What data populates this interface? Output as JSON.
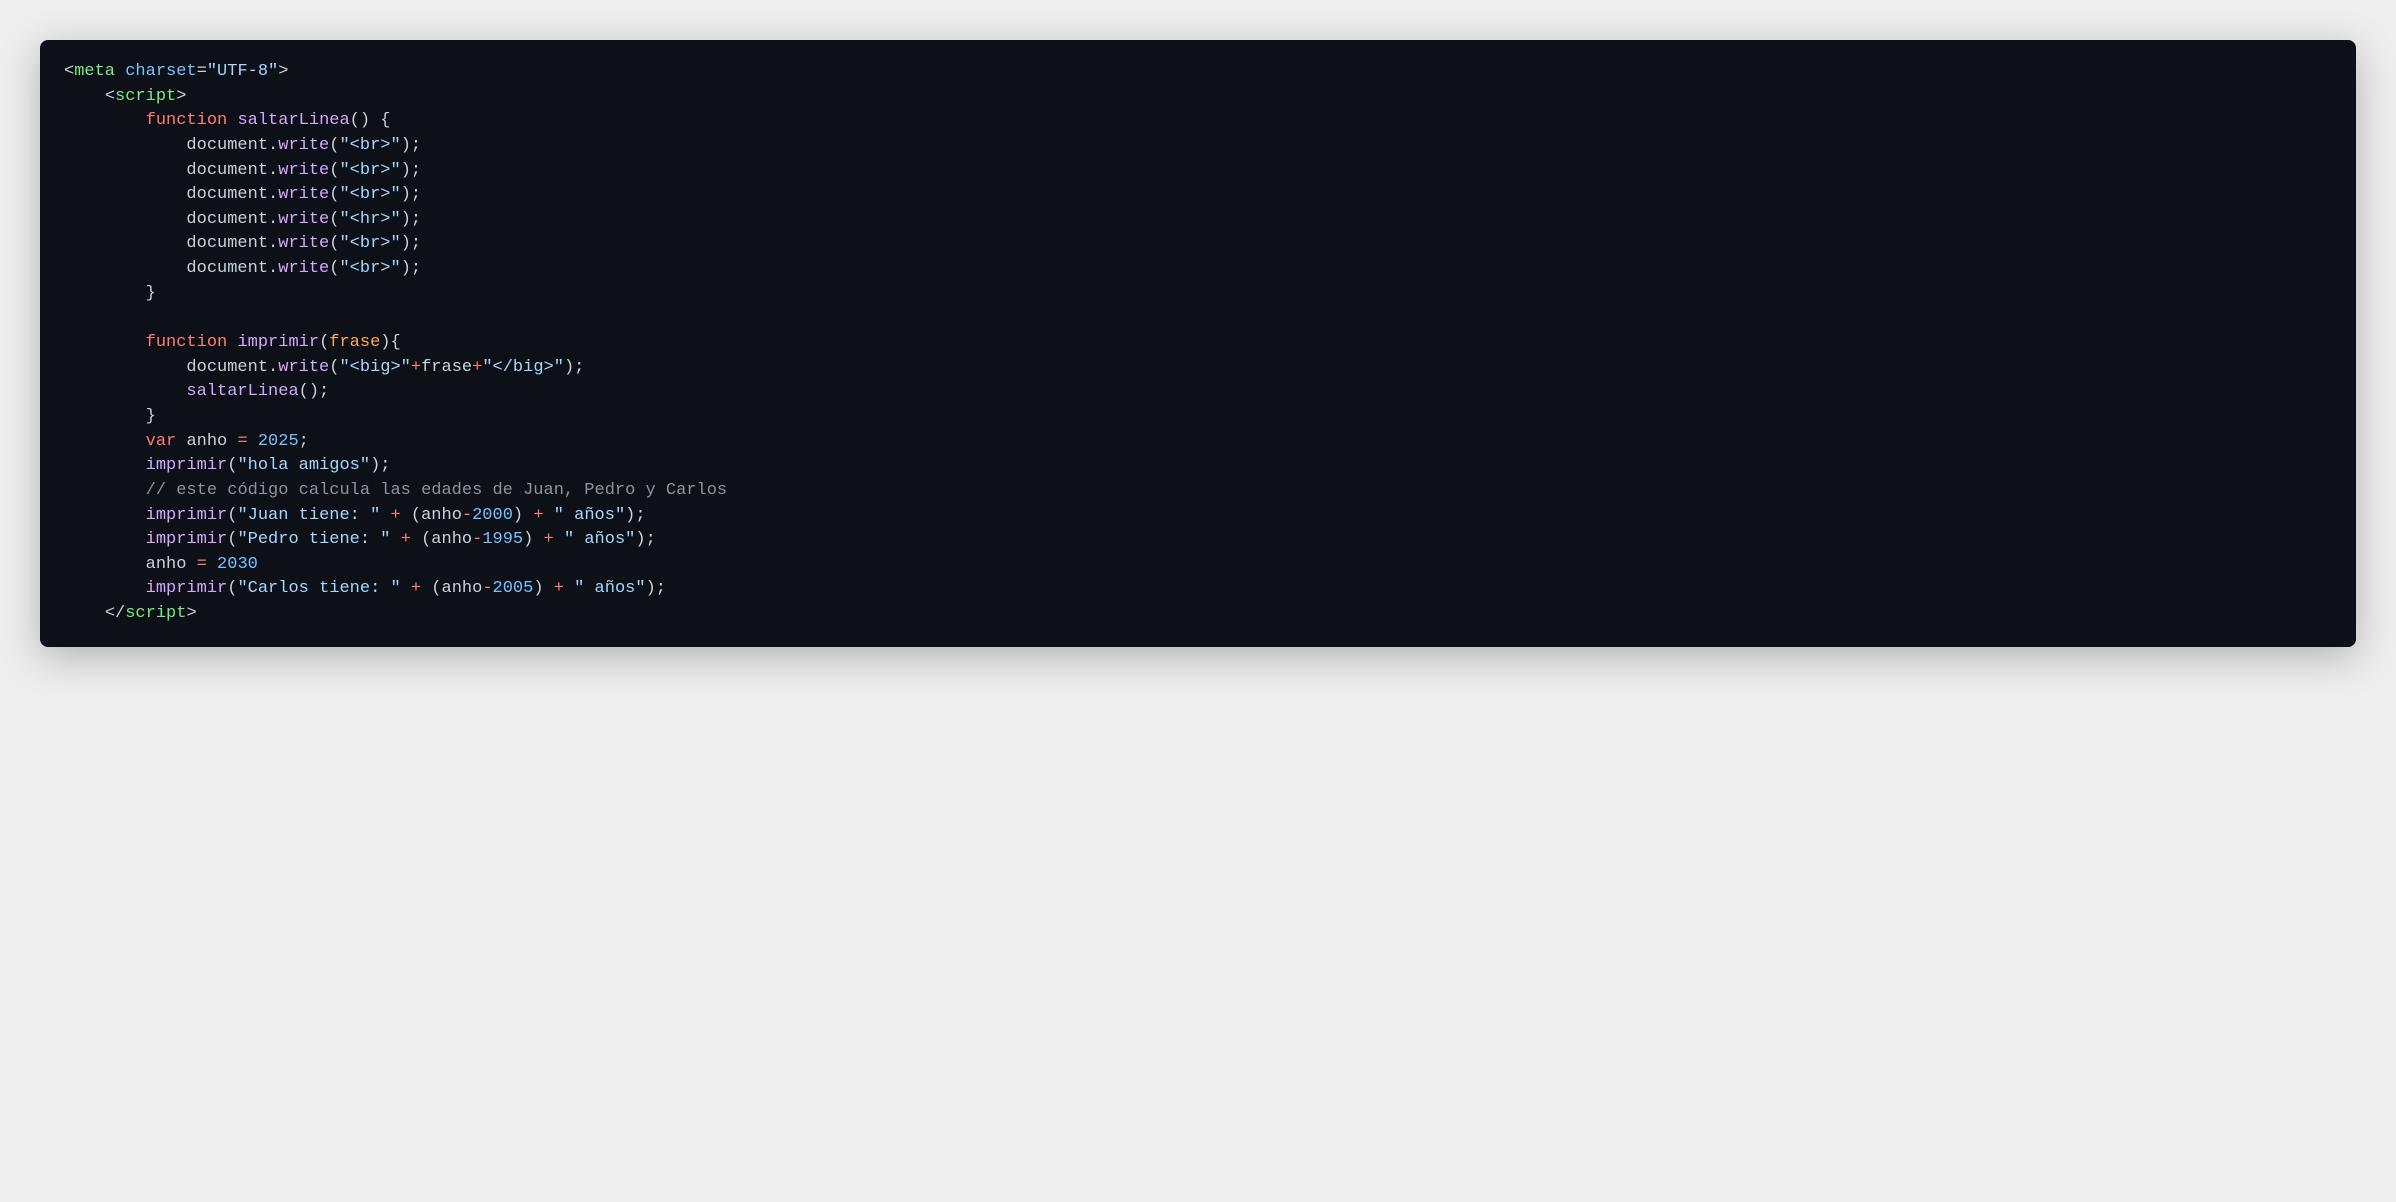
{
  "code": {
    "tokens": {
      "t_lt": "<",
      "t_gt": ">",
      "t_close": "</",
      "t_meta": "meta",
      "t_charset": "charset",
      "t_eq": "=",
      "t_utf8": "\"UTF-8\"",
      "t_script": "script",
      "t_function": "function",
      "t_saltarLinea": "saltarLinea",
      "t_lparen": "(",
      "t_rparen": ")",
      "t_lbrace": " {",
      "t_lbrace2": "{",
      "t_rbrace": "}",
      "t_document": "document",
      "t_dot": ".",
      "t_write": "write",
      "t_br": "\"<br>\"",
      "t_hr": "\"<hr>\"",
      "t_semi": ";",
      "t_imprimir": "imprimir",
      "t_frase": "frase",
      "t_big_open": "\"<big>\"",
      "t_big_close": "\"</big>\"",
      "t_plus": "+",
      "t_var": "var",
      "t_anho": "anho",
      "t_2025": "2025",
      "t_2030": "2030",
      "t_2000": "2000",
      "t_1995": "1995",
      "t_2005": "2005",
      "t_minus": "-",
      "t_hola": "\"hola amigos\"",
      "t_comment": "// este código calcula las edades de Juan, Pedro y Carlos",
      "t_juan": "\"Juan tiene: \"",
      "t_pedro": "\"Pedro tiene: \"",
      "t_carlos": "\"Carlos tiene: \"",
      "t_anos": "\" años\"",
      "t_assign": " = "
    }
  }
}
